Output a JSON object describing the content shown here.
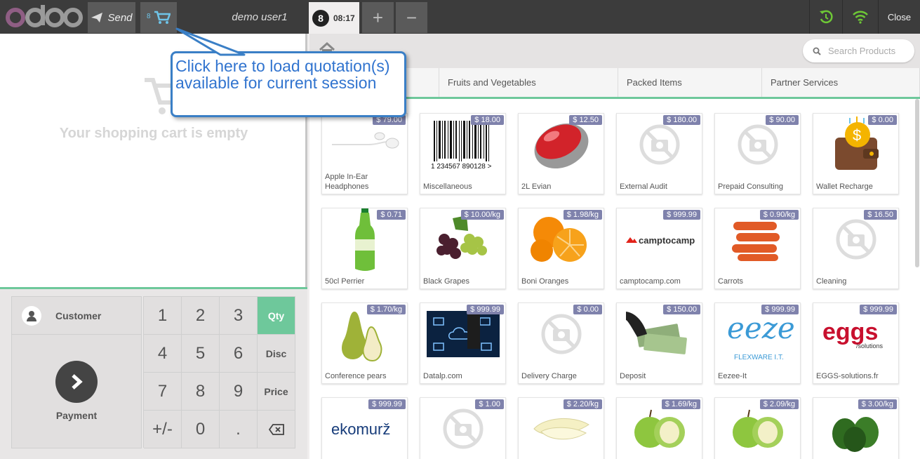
{
  "header": {
    "logo_text": "odoo",
    "send_label": "Send",
    "quotation_count": "8",
    "username": "demo user1",
    "order_number": "8",
    "order_time": "08:17",
    "add_order_symbol": "+",
    "remove_order_symbol": "−",
    "close_label": "Close"
  },
  "cart": {
    "empty_text": "Your shopping cart is empty"
  },
  "actionpad": {
    "customer_label": "Customer",
    "payment_label": "Payment"
  },
  "numpad": {
    "keys": [
      "1",
      "2",
      "3",
      "Qty",
      "4",
      "5",
      "6",
      "Disc",
      "7",
      "8",
      "9",
      "Price",
      "+/-",
      "0",
      ".",
      "backspace"
    ],
    "active_mode": "Qty"
  },
  "search": {
    "placeholder": "Search Products"
  },
  "categories": [
    "",
    "Fruits and Vegetables",
    "Packed Items",
    "Partner Services"
  ],
  "products": [
    {
      "name": "Apple In-Ear Headphones",
      "price": "$ 79.00",
      "image": "headphones"
    },
    {
      "name": "Miscellaneous",
      "price": "$ 18.00",
      "image": "barcode"
    },
    {
      "name": "2L Evian",
      "price": "$ 12.50",
      "image": "mouse"
    },
    {
      "name": "External Audit",
      "price": "$ 180.00",
      "image": "no-photo"
    },
    {
      "name": "Prepaid Consulting",
      "price": "$ 90.00",
      "image": "no-photo"
    },
    {
      "name": "Wallet Recharge",
      "price": "$ 0.00",
      "image": "wallet"
    },
    {
      "name": "50cl Perrier",
      "price": "$ 0.71",
      "image": "bottle"
    },
    {
      "name": "Black Grapes",
      "price": "$ 10.00/kg",
      "image": "grapes"
    },
    {
      "name": "Boni Oranges",
      "price": "$ 1.98/kg",
      "image": "oranges"
    },
    {
      "name": "camptocamp.com",
      "price": "$ 999.99",
      "image": "camptocamp-logo"
    },
    {
      "name": "Carrots",
      "price": "$ 0.90/kg",
      "image": "carrots"
    },
    {
      "name": "Cleaning",
      "price": "$ 16.50",
      "image": "no-photo"
    },
    {
      "name": "Conference pears",
      "price": "$ 1.70/kg",
      "image": "pears"
    },
    {
      "name": "Datalp.com",
      "price": "$ 999.99",
      "image": "datalp"
    },
    {
      "name": "Delivery Charge",
      "price": "$ 0.00",
      "image": "no-photo"
    },
    {
      "name": "Deposit",
      "price": "$ 150.00",
      "image": "money"
    },
    {
      "name": "Eezee-It",
      "price": "$ 999.99",
      "image": "eezee-logo"
    },
    {
      "name": "EGGS-solutions.fr",
      "price": "$ 999.99",
      "image": "eggs-logo"
    },
    {
      "name": "",
      "price": "$ 999.99",
      "image": "ekomurz-logo"
    },
    {
      "name": "",
      "price": "$ 1.00",
      "image": "no-photo"
    },
    {
      "name": "",
      "price": "$ 2.20/kg",
      "image": "endive"
    },
    {
      "name": "",
      "price": "$ 1.69/kg",
      "image": "green-apples"
    },
    {
      "name": "",
      "price": "$ 2.09/kg",
      "image": "green-apples"
    },
    {
      "name": "",
      "price": "$ 3.00/kg",
      "image": "peppers"
    }
  ],
  "logos": {
    "camptocamp": "camptocamp",
    "eezee": "eezee",
    "eezee_sub": "FLEXWARE I.T.",
    "eggs": "eggs",
    "eggs_sub": "/solutions",
    "ekomurz": "ekomurž"
  },
  "tooltip": {
    "line1": "Click here to load quotation(s)",
    "line2": "available for current session"
  },
  "colors": {
    "accent": "#6ec89b",
    "price_badge": "#7f82ac",
    "header": "#3c3c3c",
    "tooltip": "#3174cf"
  }
}
